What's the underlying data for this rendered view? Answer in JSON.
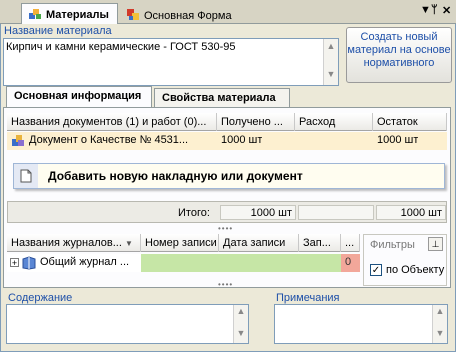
{
  "window": {
    "tabs": [
      {
        "label": "Материалы",
        "icon": "materials-icon"
      },
      {
        "label": "Основная Форма",
        "icon": "form-icon"
      }
    ],
    "controls": {
      "menu": "▼",
      "pin": "ᛘ",
      "close": "✕"
    }
  },
  "material": {
    "name_label": "Название материала",
    "name_value": "Кирпич и камни керамические - ГОСТ 530-95",
    "create_button": "Создать новый материал на основе нормативного"
  },
  "tabs": [
    {
      "label": "Основная информация",
      "active": true
    },
    {
      "label": "Свойства материала",
      "active": false
    }
  ],
  "documents": {
    "columns": [
      "Названия документов (1) и работ (0)...",
      "Получено ...",
      "Расход",
      "Остаток"
    ],
    "rows": [
      {
        "name": "Документ о Качестве № 4531...",
        "received": "1000 шт",
        "spent": "",
        "remaining": "1000 шт"
      }
    ],
    "popup_action": "Добавить новую накладную или документ",
    "totals": {
      "label": "Итого:",
      "received": "1000 шт",
      "remaining": "1000 шт"
    }
  },
  "journals": {
    "columns": [
      "Названия журналов...",
      "Номер записи",
      "Дата записи",
      "Зап...",
      "..."
    ],
    "rows": [
      {
        "name": "Общий журнал ...",
        "number": "",
        "date": "",
        "rec": "",
        "count": "0"
      }
    ],
    "filters": {
      "title": "Фильтры",
      "by_object_label": "по Объекту",
      "by_object_checked": true
    }
  },
  "content": {
    "label": "Содержание",
    "value": ""
  },
  "notes": {
    "label": "Примечания",
    "value": ""
  },
  "colors": {
    "accent_blue": "#1d4fa8",
    "selection": "#fdf0d0",
    "green": "#c6e6a6",
    "red": "#f2a79a"
  }
}
